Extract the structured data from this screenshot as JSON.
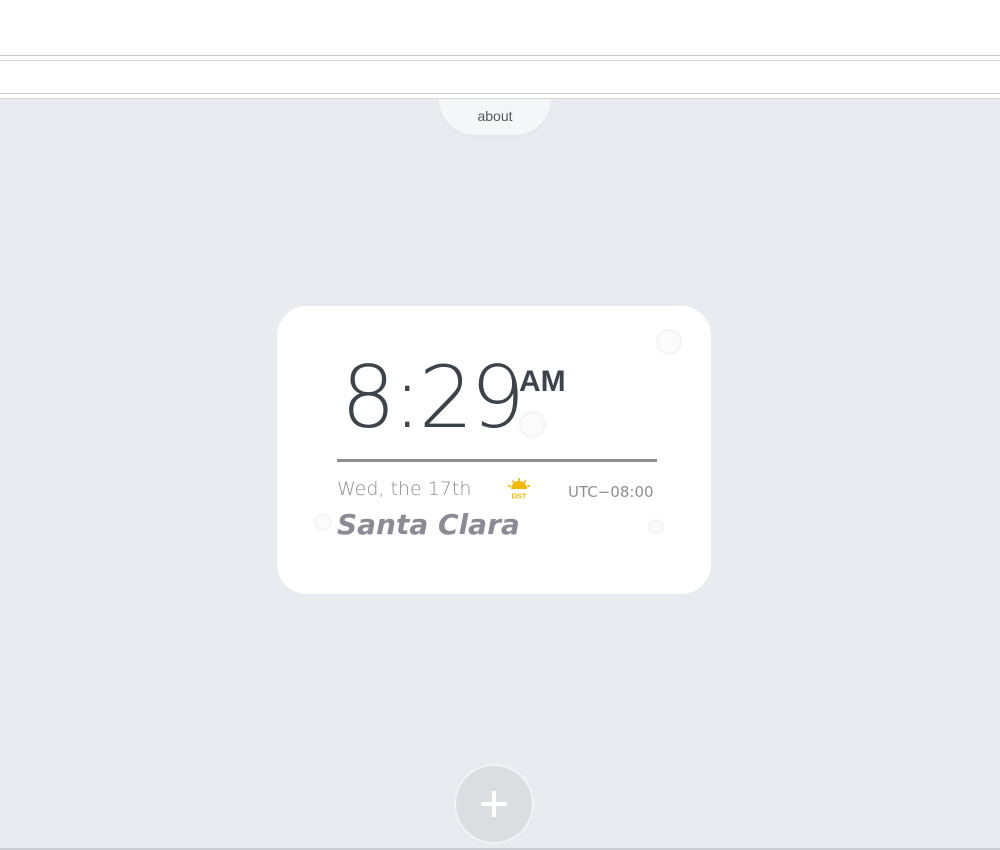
{
  "nav": {
    "about_label": "about"
  },
  "clock": {
    "time": "8:29",
    "period": "AM",
    "date": "Wed, the 17th",
    "dst_badge": "DST",
    "utc_offset": "UTC−08:00",
    "city": "Santa Clara"
  },
  "actions": {
    "add_icon": "plus-icon"
  },
  "colors": {
    "background": "#e8ecf0",
    "card": "#ffffff",
    "time_text": "#3d434b",
    "secondary_text": "#8e8e95",
    "city_text": "#8d8a96",
    "dst_yellow": "#f5b800"
  }
}
